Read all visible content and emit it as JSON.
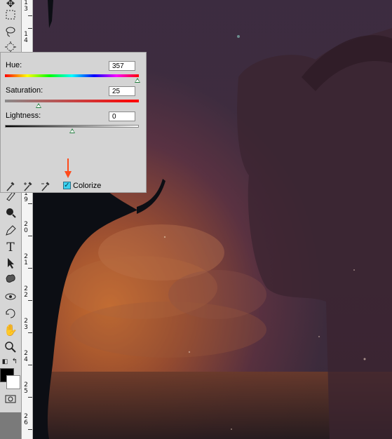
{
  "dialog": {
    "hue": {
      "label": "Hue:",
      "value": "357",
      "fraction": 0.99
    },
    "saturation": {
      "label": "Saturation:",
      "value": "25",
      "fraction": 0.25
    },
    "lightness": {
      "label": "Lightness:",
      "value": "0",
      "fraction": 0.5
    },
    "colorize": {
      "label": "Colorize",
      "checked": true
    }
  },
  "ruler": {
    "labels": [
      "1",
      "3",
      "1",
      "4",
      "1",
      "9",
      "2",
      "0",
      "2",
      "1",
      "2",
      "2",
      "2",
      "3",
      "2",
      "4",
      "2",
      "5",
      "2",
      "6"
    ]
  },
  "colors": {
    "accent": "#3ad0ee",
    "arrow": "#ff4a1a",
    "slider_thumb": "#1e7a3a"
  },
  "tools": [
    "move-icon",
    "marquee-icon",
    "lasso-icon",
    "magic-wand-icon",
    "spot-healing-icon",
    "dodge-icon",
    "pen-icon",
    "type-icon",
    "path-selection-icon",
    "custom-shape-icon",
    "3d-rotate-icon",
    "3d-orbit-icon",
    "hand-icon",
    "zoom-icon"
  ]
}
